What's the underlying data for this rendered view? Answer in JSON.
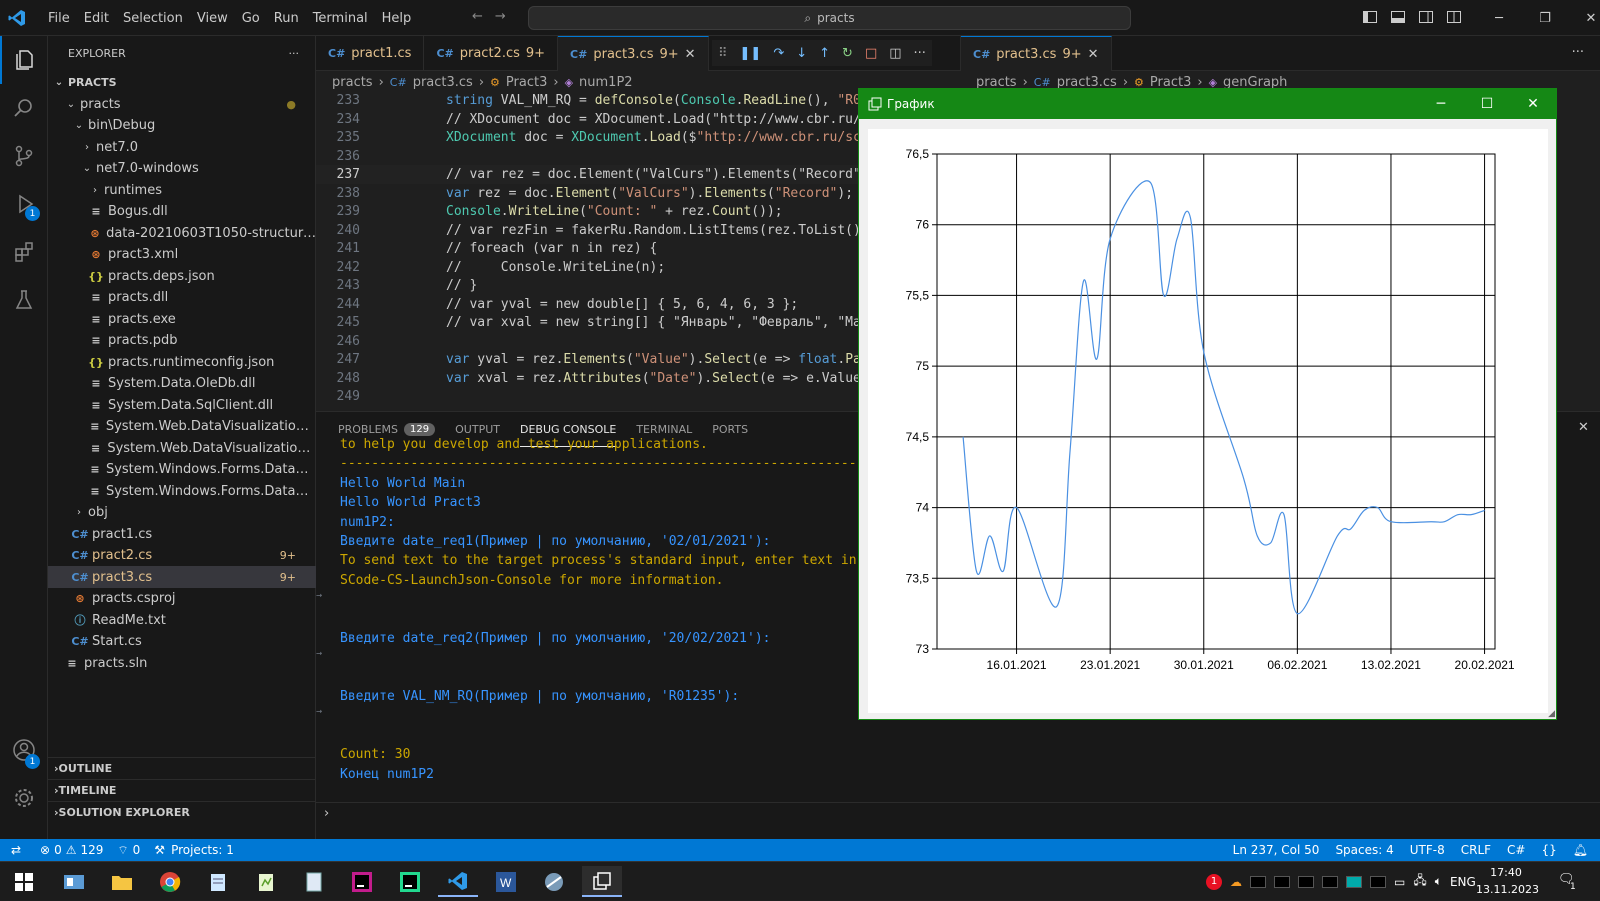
{
  "titlebar": {
    "menu": [
      "File",
      "Edit",
      "Selection",
      "View",
      "Go",
      "Run",
      "Terminal",
      "Help"
    ],
    "search": "practs"
  },
  "activity": {
    "debug_badge": "1",
    "account_badge": "1"
  },
  "explorer": {
    "title": "EXPLORER",
    "root": "PRACTS",
    "items": [
      {
        "label": "practs",
        "kind": "folder-open",
        "depth": 1,
        "mod": "dot"
      },
      {
        "label": "bin\\Debug",
        "kind": "folder-open",
        "depth": 2
      },
      {
        "label": "net7.0",
        "kind": "folder",
        "depth": 3
      },
      {
        "label": "net7.0-windows",
        "kind": "folder-open",
        "depth": 3
      },
      {
        "label": "runtimes",
        "kind": "folder",
        "depth": 4
      },
      {
        "label": "Bogus.dll",
        "kind": "file",
        "depth": 4
      },
      {
        "label": "data-20210603T1050-structure-20...",
        "kind": "rss",
        "depth": 4
      },
      {
        "label": "pract3.xml",
        "kind": "rss",
        "depth": 4
      },
      {
        "label": "practs.deps.json",
        "kind": "json",
        "depth": 4
      },
      {
        "label": "practs.dll",
        "kind": "file",
        "depth": 4
      },
      {
        "label": "practs.exe",
        "kind": "file",
        "depth": 4
      },
      {
        "label": "practs.pdb",
        "kind": "file",
        "depth": 4
      },
      {
        "label": "practs.runtimeconfig.json",
        "kind": "json",
        "depth": 4
      },
      {
        "label": "System.Data.OleDb.dll",
        "kind": "file",
        "depth": 4
      },
      {
        "label": "System.Data.SqlClient.dll",
        "kind": "file",
        "depth": 4
      },
      {
        "label": "System.Web.DataVisualization.Desi...",
        "kind": "file",
        "depth": 4
      },
      {
        "label": "System.Web.DataVisualization.dll",
        "kind": "file",
        "depth": 4
      },
      {
        "label": "System.Windows.Forms.DataVisual...",
        "kind": "file",
        "depth": 4
      },
      {
        "label": "System.Windows.Forms.DataVisual...",
        "kind": "file",
        "depth": 4
      },
      {
        "label": "obj",
        "kind": "folder",
        "depth": 2
      },
      {
        "label": "pract1.cs",
        "kind": "cs",
        "depth": 2
      },
      {
        "label": "pract2.cs",
        "kind": "cs",
        "depth": 2,
        "mod": "9+"
      },
      {
        "label": "pract3.cs",
        "kind": "cs",
        "depth": 2,
        "mod": "9+",
        "selected": true
      },
      {
        "label": "practs.csproj",
        "kind": "rss",
        "depth": 2
      },
      {
        "label": "ReadMe.txt",
        "kind": "info",
        "depth": 2
      },
      {
        "label": "Start.cs",
        "kind": "cs",
        "depth": 2
      },
      {
        "label": "practs.sln",
        "kind": "sln",
        "depth": 1
      }
    ],
    "sections": [
      "OUTLINE",
      "TIMELINE",
      "SOLUTION EXPLORER"
    ]
  },
  "tabs": [
    {
      "label": "pract1.cs",
      "mod": ""
    },
    {
      "label": "pract2.cs",
      "mod": "9+"
    },
    {
      "label": "pract3.cs",
      "mod": "9+",
      "active": true
    }
  ],
  "tabs2": [
    {
      "label": "pract3.cs",
      "mod": "9+",
      "active": true
    }
  ],
  "breadcrumb": [
    "practs",
    "pract3.cs",
    "Pract3",
    "num1P2"
  ],
  "breadcrumb2": [
    "practs",
    "pract3.cs",
    "Pract3",
    "genGraph"
  ],
  "code": [
    {
      "n": "233",
      "t": "string VAL_NM_RQ = defConsole(Console.ReadLine(), \"R01"
    },
    {
      "n": "234",
      "t": "// XDocument doc = XDocument.Load(\"http://www.cbr.ru/s"
    },
    {
      "n": "235",
      "t": "XDocument doc = XDocument.Load($\"http://www.cbr.ru/sc"
    },
    {
      "n": "236",
      "t": ""
    },
    {
      "n": "237",
      "t": "// var rez = doc.Element(\"ValCurs\").Elements(\"Record\"",
      "cur": true
    },
    {
      "n": "238",
      "t": "var rez = doc.Element(\"ValCurs\").Elements(\"Record\");"
    },
    {
      "n": "239",
      "t": "Console.WriteLine(\"Count: \" + rez.Count());"
    },
    {
      "n": "240",
      "t": "// var rezFin = fakerRu.Random.ListItems(rez.ToList()"
    },
    {
      "n": "241",
      "t": "// foreach (var n in rez) {"
    },
    {
      "n": "242",
      "t": "//     Console.WriteLine(n);"
    },
    {
      "n": "243",
      "t": "// }"
    },
    {
      "n": "244",
      "t": "// var yval = new double[] { 5, 6, 4, 6, 3 };"
    },
    {
      "n": "245",
      "t": "// var xval = new string[] { \"Январь\", \"Февраль\", \"Мар"
    },
    {
      "n": "246",
      "t": ""
    },
    {
      "n": "247",
      "t": "var yval = rez.Elements(\"Value\").Select(e => float.Pa"
    },
    {
      "n": "248",
      "t": "var xval = rez.Attributes(\"Date\").Select(e => e.Value"
    },
    {
      "n": "249",
      "t": ""
    }
  ],
  "panel": {
    "tabs": [
      "PROBLEMS",
      "OUTPUT",
      "DEBUG CONSOLE",
      "TERMINAL",
      "PORTS"
    ],
    "problems_count": "129",
    "lines": [
      {
        "t": "to help you develop and test your applications.",
        "c": "y"
      },
      {
        "t": "-------------------------------------------------------------------------------------------------------------------",
        "c": "y"
      },
      {
        "t": "Hello World Main",
        "c": "b"
      },
      {
        "t": "Hello World Pract3",
        "c": "b"
      },
      {
        "t": "num1P2:",
        "c": "b"
      },
      {
        "t": "Введите date_req1(Пример | по умолчанию, '02/01/2021'):",
        "c": "b"
      },
      {
        "t": "To send text to the target process's standard input, enter text in the Debug Console. See https://aka.ms/V",
        "c": "y"
      },
      {
        "t": "SCode-CS-LaunchJson-Console for more information.",
        "c": "y"
      },
      {
        "t": "",
        "c": "b"
      },
      {
        "t": "",
        "c": "b"
      },
      {
        "t": "Введите date_req2(Пример | по умолчанию, '20/02/2021'):",
        "c": "b"
      },
      {
        "t": "",
        "c": "b"
      },
      {
        "t": "",
        "c": "b"
      },
      {
        "t": "Введите VAL_NM_RQ(Пример | по умолчанию, 'R01235'):",
        "c": "b"
      },
      {
        "t": "",
        "c": "b"
      },
      {
        "t": "",
        "c": "b"
      },
      {
        "t": "Count: 30",
        "c": "y"
      },
      {
        "t": "Конец num1P2",
        "c": "b"
      }
    ]
  },
  "status": {
    "left": [
      "0",
      "129",
      "0",
      "Projects: 1"
    ],
    "right": [
      "Ln 237, Col 50",
      "Spaces: 4",
      "UTF-8",
      "CRLF",
      "C#"
    ]
  },
  "taskbar": {
    "lang": "ENG",
    "time": "17:40",
    "date": "13.11.2023",
    "notif": "1"
  },
  "chart_window": {
    "title": "График"
  },
  "chart_data": {
    "type": "line",
    "title": "",
    "xlabel": "",
    "ylabel": "",
    "ylim": [
      73,
      76.5
    ],
    "yticks": [
      "73",
      "73,5",
      "74",
      "74,5",
      "75",
      "75,5",
      "76",
      "76,5"
    ],
    "xticks": [
      "16.01.2021",
      "23.01.2021",
      "30.01.2021",
      "06.02.2021",
      "13.02.2021",
      "20.02.2021"
    ],
    "x": [
      "12.01.2021",
      "13.01.2021",
      "14.01.2021",
      "15.01.2021",
      "16.01.2021",
      "19.01.2021",
      "20.01.2021",
      "21.01.2021",
      "22.01.2021",
      "23.01.2021",
      "26.01.2021",
      "27.01.2021",
      "28.01.2021",
      "29.01.2021",
      "30.01.2021",
      "02.02.2021",
      "03.02.2021",
      "04.02.2021",
      "05.02.2021",
      "06.02.2021",
      "09.02.2021",
      "10.02.2021",
      "11.02.2021",
      "12.02.2021",
      "13.02.2021",
      "16.02.2021",
      "17.02.2021",
      "18.02.2021",
      "19.02.2021",
      "20.02.2021"
    ],
    "series": [
      {
        "values": [
          74.5,
          73.55,
          73.8,
          73.55,
          74.0,
          73.3,
          74.4,
          75.6,
          75.05,
          75.9,
          76.3,
          75.5,
          75.9,
          76.05,
          75.1,
          74.2,
          73.8,
          73.75,
          73.95,
          73.25,
          73.8,
          73.85,
          73.98,
          74.0,
          73.9,
          73.9,
          73.9,
          73.95,
          73.95,
          73.98
        ]
      }
    ],
    "line_color": "#4a90e2",
    "grid": true
  }
}
